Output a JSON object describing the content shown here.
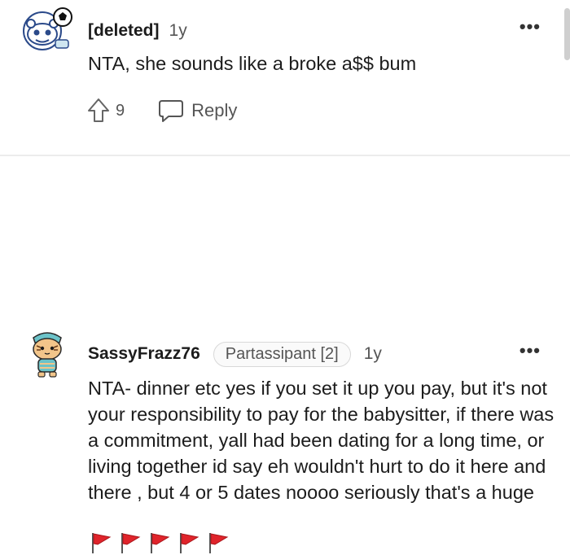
{
  "comments": [
    {
      "author": "[deleted]",
      "age": "1y",
      "text": "NTA, she sounds like a broke a$$ bum",
      "vote_count": "9",
      "reply_label": "Reply",
      "more_label": "•••"
    },
    {
      "author": "SassyFrazz76",
      "flair": "Partassipant [2]",
      "age": "1y",
      "text": "NTA- dinner etc yes if you set it up you pay, but it's not your responsibility to pay for the babysitter, if there was a commitment, yall had been dating for a long time, or living together id say eh wouldn't hurt to do it here and there , but 4 or 5 dates noooo seriously that's a huge",
      "flags": [
        "red-flag",
        "red-flag",
        "red-flag",
        "red-flag",
        "red-flag"
      ],
      "more_label": "•••"
    }
  ],
  "colors": {
    "flag_red": "#e0242b",
    "avatar_ring": "#d0d4dc",
    "teal": "#6cc3c9"
  }
}
